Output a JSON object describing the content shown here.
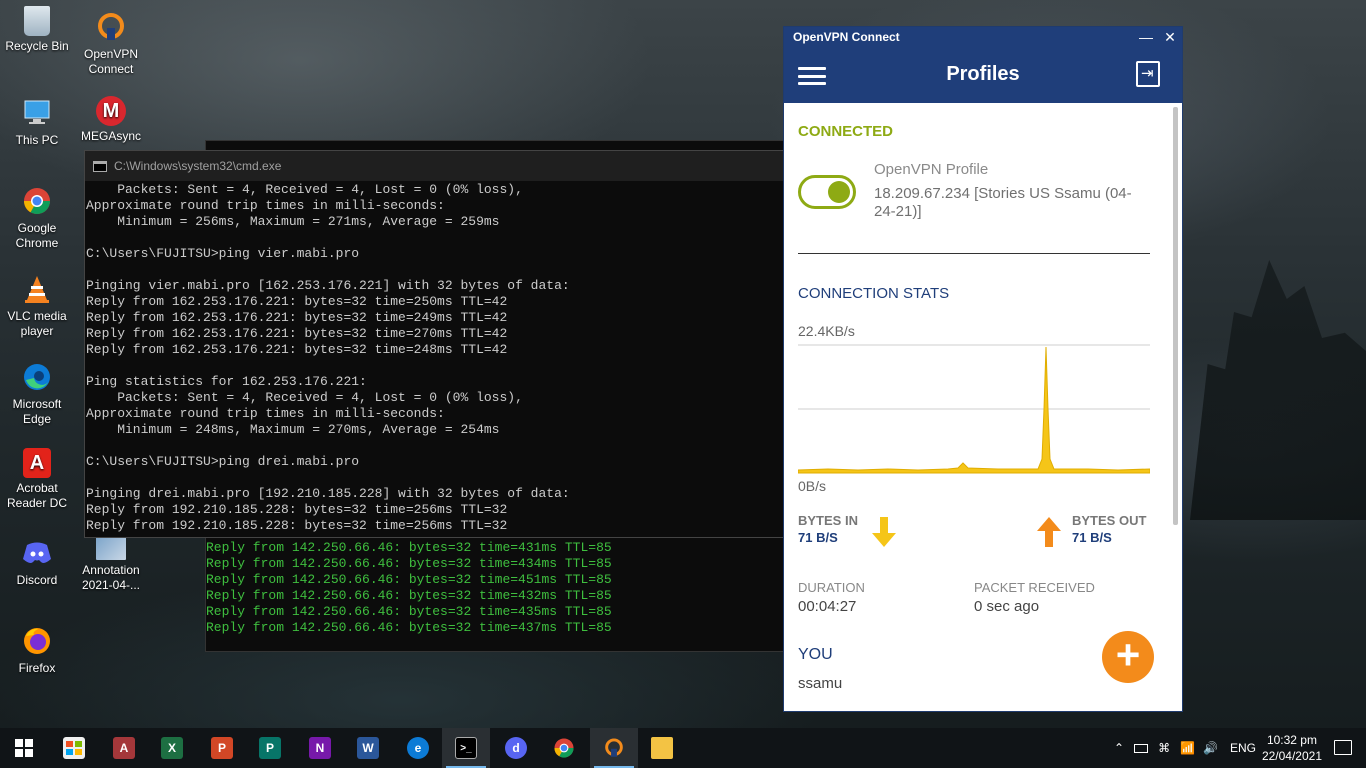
{
  "desktop": {
    "icons": [
      {
        "label": "Recycle Bin",
        "icon": "recycle-bin-icon"
      },
      {
        "label": "OpenVPN Connect",
        "icon": "openvpn-icon"
      },
      {
        "label": "This PC",
        "icon": "this-pc-icon"
      },
      {
        "label": "MEGAsync",
        "icon": "mega-icon"
      },
      {
        "label": "Google Chrome",
        "icon": "chrome-icon"
      },
      {
        "label": "VLC media player",
        "icon": "vlc-icon"
      },
      {
        "label": "Microsoft Edge",
        "icon": "edge-icon"
      },
      {
        "label": "Acrobat Reader DC",
        "icon": "acrobat-icon"
      },
      {
        "label": "Discord",
        "icon": "discord-icon"
      },
      {
        "label": "Annotation 2021-04-...",
        "icon": "image-file-icon"
      },
      {
        "label": "Firefox",
        "icon": "firefox-icon"
      }
    ]
  },
  "cmd_back": {
    "lines": [
      "Reply from 142.250.66.46: bytes=32 time=431ms TTL=85",
      "Reply from 142.250.66.46: bytes=32 time=434ms TTL=85",
      "Reply from 142.250.66.46: bytes=32 time=451ms TTL=85",
      "Reply from 142.250.66.46: bytes=32 time=432ms TTL=85",
      "Reply from 142.250.66.46: bytes=32 time=435ms TTL=85",
      "Reply from 142.250.66.46: bytes=32 time=437ms TTL=85"
    ]
  },
  "cmd": {
    "title": "C:\\Windows\\system32\\cmd.exe",
    "output": "    Packets: Sent = 4, Received = 4, Lost = 0 (0% loss),\nApproximate round trip times in milli-seconds:\n    Minimum = 256ms, Maximum = 271ms, Average = 259ms\n\nC:\\Users\\FUJITSU>ping vier.mabi.pro\n\nPinging vier.mabi.pro [162.253.176.221] with 32 bytes of data:\nReply from 162.253.176.221: bytes=32 time=250ms TTL=42\nReply from 162.253.176.221: bytes=32 time=249ms TTL=42\nReply from 162.253.176.221: bytes=32 time=270ms TTL=42\nReply from 162.253.176.221: bytes=32 time=248ms TTL=42\n\nPing statistics for 162.253.176.221:\n    Packets: Sent = 4, Received = 4, Lost = 0 (0% loss),\nApproximate round trip times in milli-seconds:\n    Minimum = 248ms, Maximum = 270ms, Average = 254ms\n\nC:\\Users\\FUJITSU>ping drei.mabi.pro\n\nPinging drei.mabi.pro [192.210.185.228] with 32 bytes of data:\nReply from 192.210.185.228: bytes=32 time=256ms TTL=32\nReply from 192.210.185.228: bytes=32 time=256ms TTL=32"
  },
  "vpn": {
    "window_title": "OpenVPN Connect",
    "minimize": "—",
    "close": "✕",
    "header_title": "Profiles",
    "status": "CONNECTED",
    "toggle_on": true,
    "profile_name": "OpenVPN Profile",
    "profile_server": "18.209.67.234 [Stories US Ssamu (04-24-21)]",
    "stats_title": "CONNECTION STATS",
    "graph_max": "22.4KB/s",
    "graph_min": "0B/s",
    "bytes_in_label": "BYTES IN",
    "bytes_in_value": "71 B/S",
    "bytes_out_label": "BYTES OUT",
    "bytes_out_value": "71 B/S",
    "duration_label": "DURATION",
    "duration_value": "00:04:27",
    "packet_label": "PACKET RECEIVED",
    "packet_value": "0 sec ago",
    "you_label": "YOU",
    "you_value": "ssamu",
    "add_button": "+",
    "colors": {
      "brand": "#1f3e7a",
      "connected": "#8eaa14",
      "accent": "#f38b1b",
      "graph": "#f5c518"
    }
  },
  "taskbar": {
    "items": [
      {
        "name": "start",
        "icon": "windows-icon"
      },
      {
        "name": "store",
        "icon": "store-icon"
      },
      {
        "name": "access",
        "icon": "access-icon"
      },
      {
        "name": "excel",
        "icon": "excel-icon"
      },
      {
        "name": "powerpoint",
        "icon": "powerpoint-icon"
      },
      {
        "name": "publisher",
        "icon": "publisher-icon"
      },
      {
        "name": "onenote",
        "icon": "onenote-icon"
      },
      {
        "name": "word",
        "icon": "word-icon"
      },
      {
        "name": "edge",
        "icon": "edge-icon"
      },
      {
        "name": "cmd",
        "icon": "terminal-icon"
      },
      {
        "name": "discord",
        "icon": "discord-icon"
      },
      {
        "name": "chrome",
        "icon": "chrome-icon"
      },
      {
        "name": "openvpn",
        "icon": "openvpn-icon"
      },
      {
        "name": "explorer",
        "icon": "folder-icon"
      }
    ],
    "language": "ENG",
    "time": "10:32 pm",
    "date": "22/04/2021"
  }
}
